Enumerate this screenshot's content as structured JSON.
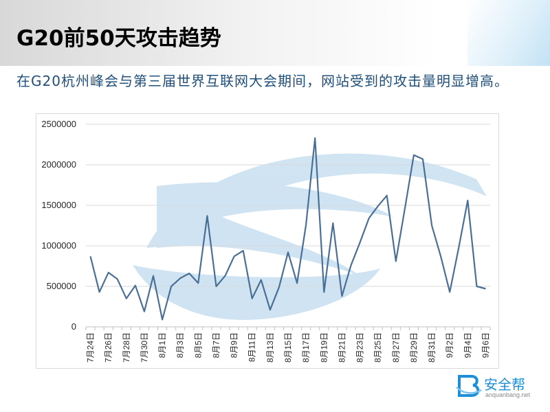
{
  "slide": {
    "title": "G20前50天攻击趋势",
    "subtitle": "在G20杭州峰会与第三届世界互联网大会期间，网站受到的攻击量明显增高。"
  },
  "brand": {
    "name": "安全帮",
    "url": "anquanbang.net",
    "icon": "b-letter-logo-icon"
  },
  "colors": {
    "line": "#4a6f95",
    "watermark": "#a9cde8",
    "grid": "#d9d9d9",
    "subtitle": "#1f4e79",
    "brand": "#1d8ed8"
  },
  "chart_data": {
    "type": "line",
    "title": "",
    "xlabel": "",
    "ylabel": "",
    "ylim": [
      0,
      2500000
    ],
    "yticks": [
      0,
      500000,
      1000000,
      1500000,
      2000000,
      2500000
    ],
    "ytick_labels": [
      "0",
      "500000",
      "1000000",
      "1500000",
      "2000000",
      "2500000"
    ],
    "grid": "horizontal",
    "legend": "none",
    "x_tick_labels": [
      "7月24日",
      "7月26日",
      "7月28日",
      "7月30日",
      "8月1日",
      "8月3日",
      "8月5日",
      "8月7日",
      "8月9日",
      "8月11日",
      "8月13日",
      "8月15日",
      "8月17日",
      "8月19日",
      "8月21日",
      "8月23日",
      "8月25日",
      "8月27日",
      "8月29日",
      "8月31日",
      "9月2日",
      "9月4日",
      "9月6日"
    ],
    "x": [
      "7月24日",
      "7月25日",
      "7月26日",
      "7月27日",
      "7月28日",
      "7月29日",
      "7月30日",
      "7月31日",
      "8月1日",
      "8月2日",
      "8月3日",
      "8月4日",
      "8月5日",
      "8月6日",
      "8月7日",
      "8月8日",
      "8月9日",
      "8月10日",
      "8月11日",
      "8月12日",
      "8月13日",
      "8月14日",
      "8月15日",
      "8月16日",
      "8月17日",
      "8月18日",
      "8月19日",
      "8月20日",
      "8月21日",
      "8月22日",
      "8月23日",
      "8月24日",
      "8月25日",
      "8月26日",
      "8月27日",
      "8月28日",
      "8月29日",
      "8月30日",
      "8月31日",
      "9月1日",
      "9月2日",
      "9月3日",
      "9月4日",
      "9月5日",
      "9月6日"
    ],
    "series": [
      {
        "values": [
          870000,
          430000,
          670000,
          590000,
          350000,
          510000,
          190000,
          630000,
          90000,
          500000,
          600000,
          660000,
          540000,
          1370000,
          500000,
          630000,
          870000,
          940000,
          350000,
          580000,
          210000,
          490000,
          920000,
          540000,
          1260000,
          2330000,
          430000,
          1280000,
          380000,
          760000,
          1040000,
          1340000,
          1490000,
          1620000,
          810000,
          1460000,
          2120000,
          2070000,
          1250000,
          870000,
          430000,
          980000,
          1560000,
          500000,
          470000
        ]
      }
    ]
  }
}
